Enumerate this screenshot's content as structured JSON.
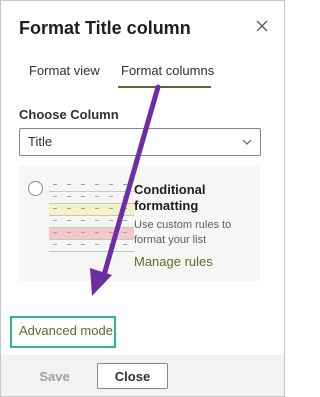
{
  "panel": {
    "title": "Format Title column",
    "close_icon": "close-icon"
  },
  "tabs": [
    {
      "label": "Format view",
      "active": false
    },
    {
      "label": "Format columns",
      "active": true
    }
  ],
  "choose_column": {
    "label": "Choose Column",
    "value": "Title",
    "chevron_icon": "chevron-down-icon"
  },
  "conditional_card": {
    "title": "Conditional formatting",
    "description": "Use custom rules to format your list",
    "link": "Manage rules",
    "radio_selected": false
  },
  "advanced_mode": {
    "label": "Advanced mode",
    "highlight_color": "#2bb39b"
  },
  "footer": {
    "save_label": "Save",
    "save_disabled": true,
    "close_label": "Close"
  },
  "colors": {
    "accent": "#5c6b2a",
    "annotation_arrow": "#6b2fa3"
  }
}
